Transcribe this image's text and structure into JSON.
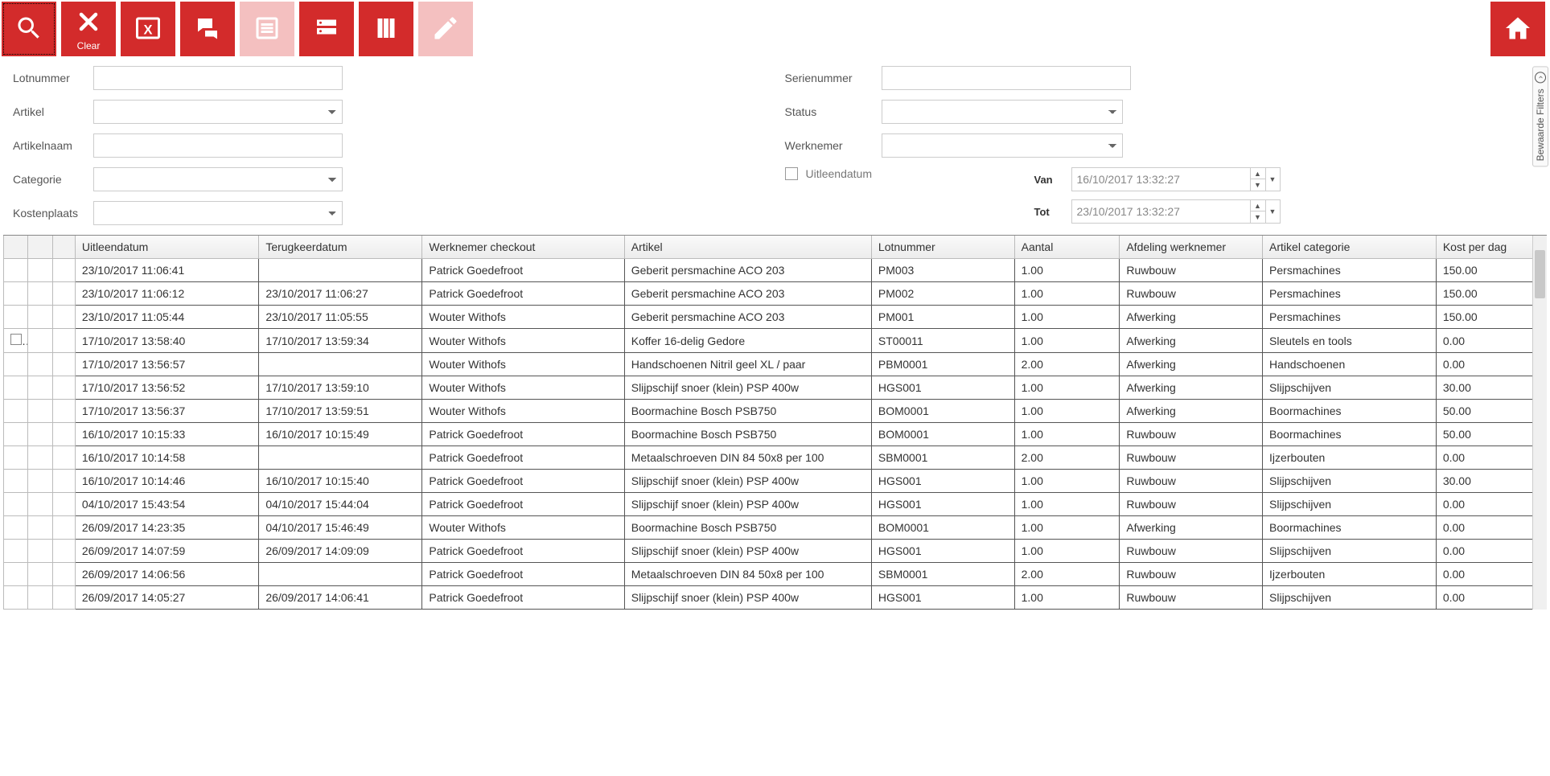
{
  "toolbar": {
    "clear_label": "Clear"
  },
  "side_tab": "Bewaarde Filters",
  "filters": {
    "left": {
      "lotnummer": {
        "label": "Lotnummer",
        "value": ""
      },
      "artikel": {
        "label": "Artikel",
        "value": ""
      },
      "artikelnaam": {
        "label": "Artikelnaam",
        "value": ""
      },
      "categorie": {
        "label": "Categorie",
        "value": ""
      },
      "kostenplaats": {
        "label": "Kostenplaats",
        "value": ""
      }
    },
    "right": {
      "serienummer": {
        "label": "Serienummer",
        "value": ""
      },
      "status": {
        "label": "Status",
        "value": ""
      },
      "werknemer": {
        "label": "Werknemer",
        "value": ""
      },
      "uitleendatum": {
        "label": "Uitleendatum",
        "checked": false
      },
      "van": {
        "label": "Van",
        "value": "16/10/2017 13:32:27"
      },
      "tot": {
        "label": "Tot",
        "value": "23/10/2017 13:32:27"
      }
    }
  },
  "columns": {
    "uitleendatum": "Uitleendatum",
    "terugkeerdatum": "Terugkeerdatum",
    "werknemer_checkout": "Werknemer checkout",
    "artikel": "Artikel",
    "lotnummer": "Lotnummer",
    "aantal": "Aantal",
    "afdeling_werknemer": "Afdeling werknemer",
    "artikel_categorie": "Artikel categorie",
    "kost_per_dag": "Kost per dag"
  },
  "rows": [
    {
      "sel": false,
      "uit": "23/10/2017 11:06:41",
      "terug": "",
      "werk": "Patrick Goedefroot",
      "art": "Geberit persmachine ACO 203",
      "lot": "PM003",
      "aant": "1.00",
      "afd": "Ruwbouw",
      "cat": "Persmachines",
      "kost": "150.00"
    },
    {
      "sel": false,
      "uit": "23/10/2017 11:06:12",
      "terug": "23/10/2017 11:06:27",
      "werk": "Patrick Goedefroot",
      "art": "Geberit persmachine ACO 203",
      "lot": "PM002",
      "aant": "1.00",
      "afd": "Ruwbouw",
      "cat": "Persmachines",
      "kost": "150.00"
    },
    {
      "sel": false,
      "uit": "23/10/2017 11:05:44",
      "terug": "23/10/2017 11:05:55",
      "werk": "Wouter Withofs",
      "art": "Geberit persmachine ACO 203",
      "lot": "PM001",
      "aant": "1.00",
      "afd": "Afwerking",
      "cat": "Persmachines",
      "kost": "150.00"
    },
    {
      "sel": true,
      "uit": "17/10/2017 13:58:40",
      "terug": "17/10/2017 13:59:34",
      "werk": "Wouter Withofs",
      "art": "Koffer 16-delig Gedore",
      "lot": "ST00011",
      "aant": "1.00",
      "afd": "Afwerking",
      "cat": "Sleutels en tools",
      "kost": "0.00"
    },
    {
      "sel": false,
      "uit": "17/10/2017 13:56:57",
      "terug": "",
      "werk": "Wouter Withofs",
      "art": "Handschoenen Nitril geel XL / paar",
      "lot": "PBM0001",
      "aant": "2.00",
      "afd": "Afwerking",
      "cat": "Handschoenen",
      "kost": "0.00"
    },
    {
      "sel": false,
      "uit": "17/10/2017 13:56:52",
      "terug": "17/10/2017 13:59:10",
      "werk": "Wouter Withofs",
      "art": "Slijpschijf snoer (klein) PSP 400w",
      "lot": "HGS001",
      "aant": "1.00",
      "afd": "Afwerking",
      "cat": "Slijpschijven",
      "kost": "30.00"
    },
    {
      "sel": false,
      "uit": "17/10/2017 13:56:37",
      "terug": "17/10/2017 13:59:51",
      "werk": "Wouter Withofs",
      "art": "Boormachine Bosch PSB750",
      "lot": "BOM0001",
      "aant": "1.00",
      "afd": "Afwerking",
      "cat": "Boormachines",
      "kost": "50.00"
    },
    {
      "sel": false,
      "uit": "16/10/2017 10:15:33",
      "terug": "16/10/2017 10:15:49",
      "werk": "Patrick Goedefroot",
      "art": "Boormachine Bosch PSB750",
      "lot": "BOM0001",
      "aant": "1.00",
      "afd": "Ruwbouw",
      "cat": "Boormachines",
      "kost": "50.00"
    },
    {
      "sel": false,
      "uit": "16/10/2017 10:14:58",
      "terug": "",
      "werk": "Patrick Goedefroot",
      "art": "Metaalschroeven DIN 84 50x8 per 100",
      "lot": "SBM0001",
      "aant": "2.00",
      "afd": "Ruwbouw",
      "cat": "Ijzerbouten",
      "kost": "0.00"
    },
    {
      "sel": false,
      "uit": "16/10/2017 10:14:46",
      "terug": "16/10/2017 10:15:40",
      "werk": "Patrick Goedefroot",
      "art": "Slijpschijf snoer (klein) PSP 400w",
      "lot": "HGS001",
      "aant": "1.00",
      "afd": "Ruwbouw",
      "cat": "Slijpschijven",
      "kost": "30.00"
    },
    {
      "sel": false,
      "uit": "04/10/2017 15:43:54",
      "terug": "04/10/2017 15:44:04",
      "werk": "Patrick Goedefroot",
      "art": "Slijpschijf snoer (klein) PSP 400w",
      "lot": "HGS001",
      "aant": "1.00",
      "afd": "Ruwbouw",
      "cat": "Slijpschijven",
      "kost": "0.00"
    },
    {
      "sel": false,
      "uit": "26/09/2017 14:23:35",
      "terug": "04/10/2017 15:46:49",
      "werk": "Wouter Withofs",
      "art": "Boormachine Bosch PSB750",
      "lot": "BOM0001",
      "aant": "1.00",
      "afd": "Afwerking",
      "cat": "Boormachines",
      "kost": "0.00"
    },
    {
      "sel": false,
      "uit": "26/09/2017 14:07:59",
      "terug": "26/09/2017 14:09:09",
      "werk": "Patrick Goedefroot",
      "art": "Slijpschijf snoer (klein) PSP 400w",
      "lot": "HGS001",
      "aant": "1.00",
      "afd": "Ruwbouw",
      "cat": "Slijpschijven",
      "kost": "0.00"
    },
    {
      "sel": false,
      "uit": "26/09/2017 14:06:56",
      "terug": "",
      "werk": "Patrick Goedefroot",
      "art": "Metaalschroeven DIN 84 50x8 per 100",
      "lot": "SBM0001",
      "aant": "2.00",
      "afd": "Ruwbouw",
      "cat": "Ijzerbouten",
      "kost": "0.00"
    },
    {
      "sel": false,
      "uit": "26/09/2017 14:05:27",
      "terug": "26/09/2017 14:06:41",
      "werk": "Patrick Goedefroot",
      "art": "Slijpschijf snoer (klein) PSP 400w",
      "lot": "HGS001",
      "aant": "1.00",
      "afd": "Ruwbouw",
      "cat": "Slijpschijven",
      "kost": "0.00"
    }
  ]
}
